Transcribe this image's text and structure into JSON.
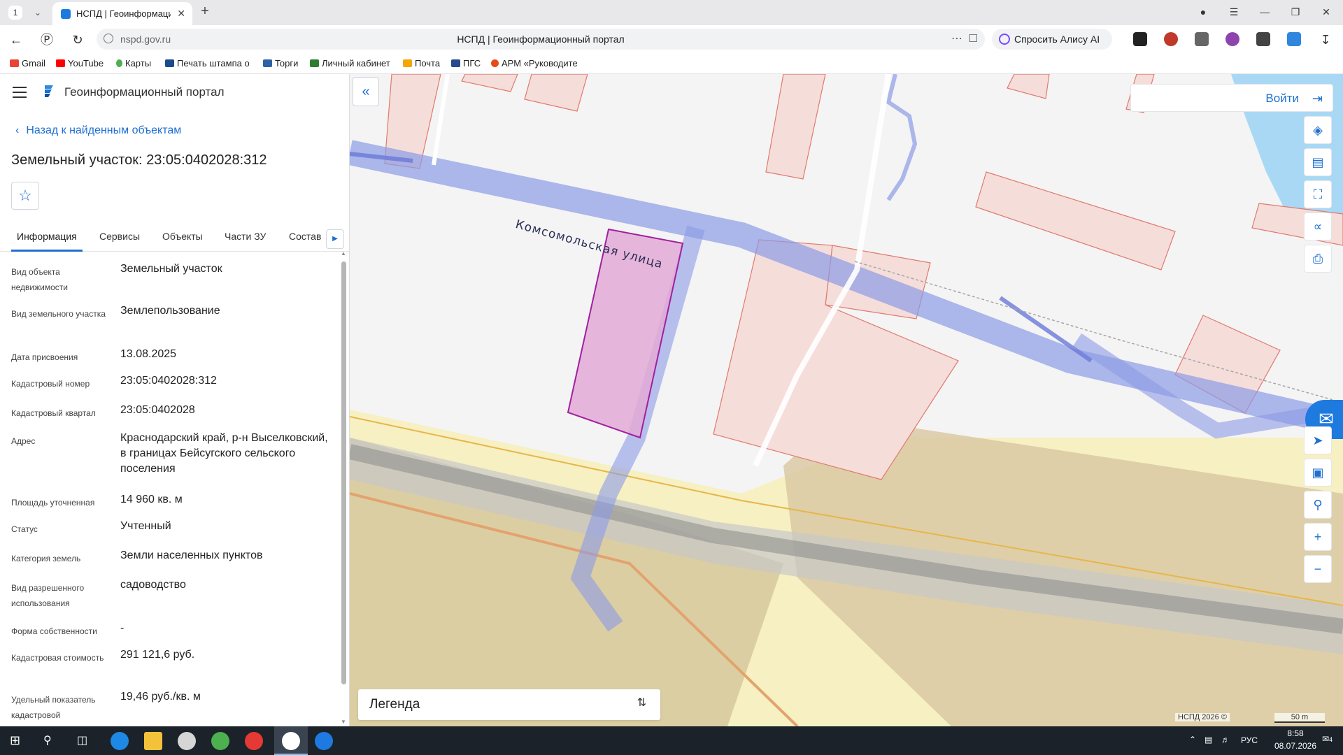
{
  "browser": {
    "tab_count": "1",
    "tab_title": "НСПД | Геоинформаци",
    "url_domain": "nspd.gov.ru",
    "page_title": "НСПД | Геоинформационный портал",
    "alice_label": "Спросить Алису AI"
  },
  "bookmarks": [
    {
      "label": "Gmail",
      "color": "#ea4335"
    },
    {
      "label": "YouTube",
      "color": "#ff0000"
    },
    {
      "label": "Карты",
      "color": "#4caf50"
    },
    {
      "label": "Печать штампа о",
      "color": "#1a4b8c"
    },
    {
      "label": "Торги",
      "color": "#2e62a6"
    },
    {
      "label": "Личный кабинет",
      "color": "#2e7d32"
    },
    {
      "label": "Почта",
      "color": "#f4a700"
    },
    {
      "label": "ПГС",
      "color": "#264a8a"
    },
    {
      "label": "АРМ «Руководите",
      "color": "#e64a19"
    }
  ],
  "panel": {
    "portal_title": "Геоинформационный портал",
    "back_link": "Назад к найденным объектам",
    "object_title": "Земельный участок: 23:05:0402028:312",
    "tabs": [
      "Информация",
      "Сервисы",
      "Объекты",
      "Части ЗУ",
      "Состав"
    ],
    "properties": [
      {
        "label": "Вид объекта недвижимости",
        "value": "Земельный участок"
      },
      {
        "label": "Вид земельного участка",
        "value": "Землепользование"
      },
      {
        "label": "Дата присвоения",
        "value": "13.08.2025"
      },
      {
        "label": "Кадастровый номер",
        "value": "23:05:0402028:312"
      },
      {
        "label": "Кадастровый квартал",
        "value": "23:05:0402028"
      },
      {
        "label": "Адрес",
        "value": "Краснодарский край, р-н Выселковский, в границах Бейсугского сельского поселения"
      },
      {
        "label": "Площадь уточненная",
        "value": "14 960 кв. м"
      },
      {
        "label": "Статус",
        "value": "Учтенный"
      },
      {
        "label": "Категория земель",
        "value": "Земли населенных пунктов"
      },
      {
        "label": "Вид разрешенного использования",
        "value": "садоводство"
      },
      {
        "label": "Форма собственности",
        "value": "-"
      },
      {
        "label": "Кадастровая стоимость",
        "value": "291 121,6 руб."
      },
      {
        "label": "Удельный показатель кадастровой",
        "value": "19,46 руб./кв. м"
      }
    ]
  },
  "map": {
    "login_label": "Войти",
    "street_name": "Комсомольская улица",
    "legend_label": "Легенда",
    "copyright": "НСПД 2026 ©",
    "scale_label": "50 m",
    "tools": [
      "layers-icon",
      "ruler-icon",
      "select-area-icon",
      "share-icon",
      "print-icon"
    ],
    "nav_tools": [
      "locate-icon",
      "minimap-icon",
      "zoom-area-icon",
      "zoom-in-icon",
      "zoom-out-icon"
    ],
    "colors": {
      "road": "#8c9be6",
      "parcel_fill": "#f5ddda",
      "parcel_stroke": "#e07a6e",
      "selected_fill": "#e3a9d6",
      "selected_stroke": "#a020a0",
      "zone_yellow": "#f6f0c2",
      "zone_brown": "#d4c39a",
      "water": "#a9d8f5"
    }
  },
  "taskbar": {
    "language": "РУС",
    "time": "8:58",
    "date": "08.07.2026",
    "notifications": "4"
  }
}
